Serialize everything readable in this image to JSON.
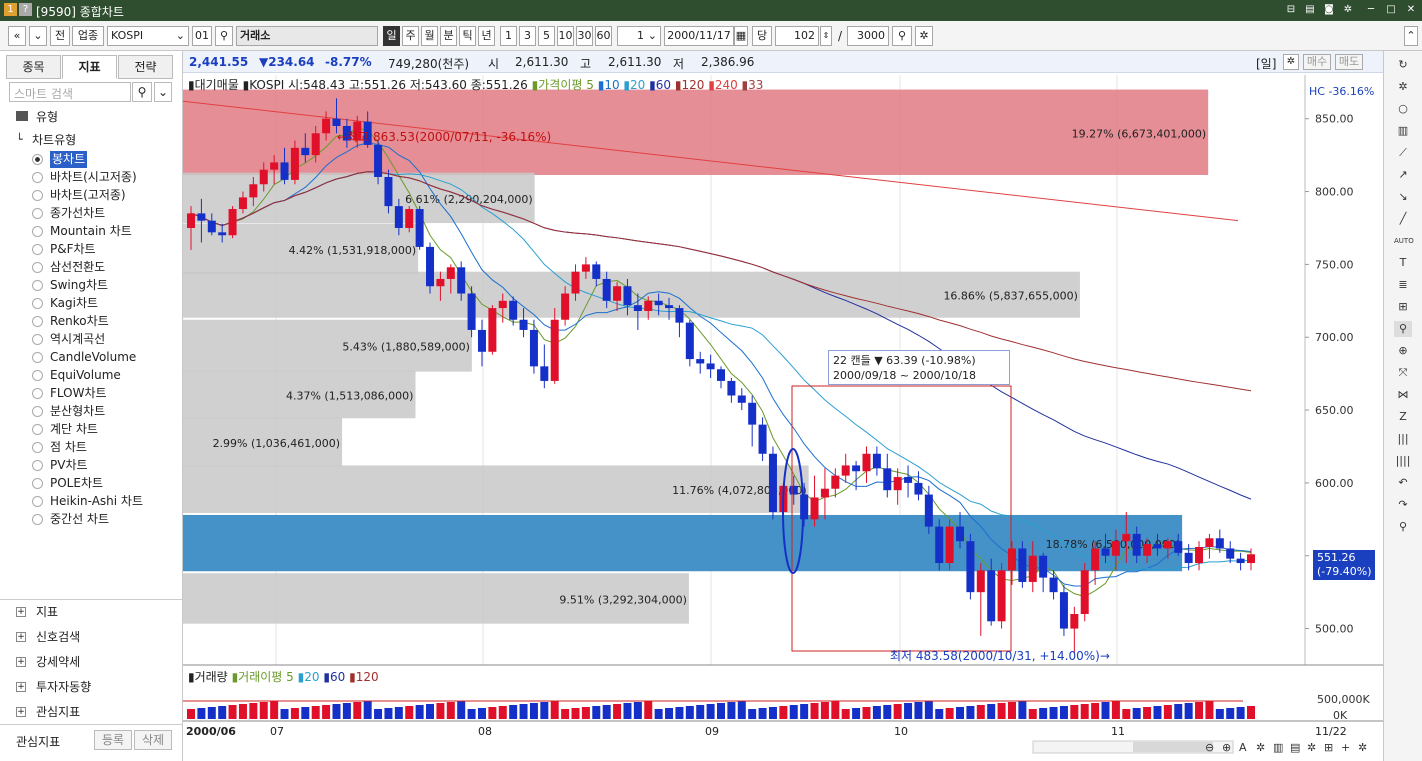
{
  "titlebar": {
    "icon1": "1",
    "icon2": "?",
    "title": "[9590] 종합차트"
  },
  "toolbar": {
    "nav_prev": "«",
    "nav_down": "»",
    "prev_label": "전",
    "market_type": "업종",
    "index_name": "KOSPI",
    "index_code": "01",
    "exchange": "거래소",
    "period_tabs": [
      "일",
      "주",
      "월",
      "분",
      "틱",
      "년"
    ],
    "intervals": [
      "1",
      "3",
      "5",
      "10",
      "30",
      "60"
    ],
    "count_value": "1",
    "date_value": "2000/11/17",
    "date_label": "당",
    "view_count": "102",
    "total_count": "3000",
    "colors": {
      "active": "#333333"
    }
  },
  "leftpanel": {
    "tabs": [
      "종목",
      "지표",
      "전략"
    ],
    "search_placeholder": "스마트 검색",
    "group_label": "유형",
    "subgroup_label": "차트유형",
    "chart_types": [
      "봉차트",
      "바차트(시고저종)",
      "바차트(고저종)",
      "종가선차트",
      "Mountain 차트",
      "P&F차트",
      "삼선전환도",
      "Swing차트",
      "Kagi차트",
      "Renko차트",
      "역시계곡선",
      "CandleVolume",
      "EquiVolume",
      "FLOW차트",
      "분산형차트",
      "계단 차트",
      "점 차트",
      "PV차트",
      "POLE차트",
      "Heikin-Ashi 차트",
      "중간선 차트"
    ],
    "selected_type": "봉차트",
    "sections": [
      "지표",
      "신호검색",
      "강세약세",
      "투자자동향",
      "관심지표"
    ],
    "footer": {
      "label": "관심지표",
      "register": "등록",
      "delete": "삭제"
    }
  },
  "quote": {
    "price": "2,441.55",
    "change": "▼234.64",
    "pct": "-8.77%",
    "volume": "749,280(천주)",
    "open_label": "시",
    "open": "2,611.30",
    "high_label": "고",
    "high": "2,611.30",
    "low_label": "저",
    "low": "2,386.96",
    "period": "[일]",
    "buy": "매수",
    "sell": "매도"
  },
  "legend": {
    "prefix": "▮대기매물",
    "ohlc": "▮KOSPI 시:548.43 고:551.26 저:543.60 종:551.26",
    "ma_label": "가격이평",
    "ma": [
      "5",
      "10",
      "20",
      "60",
      "120",
      "240",
      "33"
    ],
    "hc": "HC -36.16%",
    "cur_price": "551.26",
    "cur_pct": "(-79.40%)"
  },
  "annotations": {
    "high": "←최고 863.53(2000/07/11, -36.16%)",
    "low": "최저 483.58(2000/10/31, +14.00%)→",
    "box_title": "22 캔들 ▼ 63.39 (-10.98%)",
    "box_range": "2000/09/18 ~ 2000/10/18"
  },
  "volume_legend": {
    "prefix": "▮거래량",
    "ma_label": "거래이평",
    "ma": [
      "5",
      "20",
      "60",
      "120"
    ],
    "ticks": [
      "500,000K",
      "0K"
    ]
  },
  "chart_data": {
    "type": "candlestick",
    "title": "KOSPI",
    "ylim": [
      475,
      880
    ],
    "yticks": [
      "850.00",
      "800.00",
      "750.00",
      "700.00",
      "650.00",
      "600.00",
      "550.00",
      "500.00"
    ],
    "xticks": [
      "2000/06",
      "07",
      "08",
      "09",
      "10",
      "11",
      "11/22"
    ],
    "volume_profile": [
      {
        "range": [
          810,
          870
        ],
        "label": "19.27% (6,673,401,000)",
        "highlight": "red"
      },
      {
        "range": [
          777,
          813
        ],
        "label": "6.61% (2,290,204,000)"
      },
      {
        "range": [
          742,
          778
        ],
        "label": "4.42% (1,531,918,000)"
      },
      {
        "range": [
          712,
          745
        ],
        "label": "16.86% (5,837,655,000)"
      },
      {
        "range": [
          675,
          712
        ],
        "label": "5.43% (1,880,589,000)"
      },
      {
        "range": [
          643,
          677
        ],
        "label": "4.37% (1,513,086,000)"
      },
      {
        "range": [
          610,
          645
        ],
        "label": "2.99% (1,036,461,000)"
      },
      {
        "range": [
          578,
          612
        ],
        "label": "11.76% (4,072,804,000)"
      },
      {
        "range": [
          538,
          578
        ],
        "label": "18.78% (6,500,000,000)",
        "highlight": "blue"
      },
      {
        "range": [
          502,
          538
        ],
        "label": "9.51% (3,292,304,000)"
      }
    ],
    "candles": [
      [
        775,
        790,
        760,
        785
      ],
      [
        785,
        795,
        765,
        780
      ],
      [
        780,
        785,
        770,
        772
      ],
      [
        772,
        778,
        765,
        770
      ],
      [
        770,
        790,
        768,
        788
      ],
      [
        788,
        800,
        785,
        796
      ],
      [
        796,
        810,
        790,
        805
      ],
      [
        805,
        820,
        800,
        815
      ],
      [
        815,
        825,
        805,
        820
      ],
      [
        820,
        830,
        805,
        808
      ],
      [
        808,
        835,
        805,
        830
      ],
      [
        830,
        840,
        820,
        825
      ],
      [
        825,
        845,
        820,
        840
      ],
      [
        840,
        855,
        835,
        850
      ],
      [
        850,
        864,
        840,
        845
      ],
      [
        845,
        850,
        830,
        835
      ],
      [
        835,
        852,
        830,
        848
      ],
      [
        848,
        855,
        830,
        832
      ],
      [
        832,
        835,
        805,
        810
      ],
      [
        810,
        815,
        785,
        790
      ],
      [
        790,
        795,
        770,
        775
      ],
      [
        775,
        790,
        772,
        788
      ],
      [
        788,
        790,
        760,
        762
      ],
      [
        762,
        765,
        730,
        735
      ],
      [
        735,
        745,
        725,
        740
      ],
      [
        740,
        750,
        730,
        748
      ],
      [
        748,
        752,
        725,
        730
      ],
      [
        730,
        735,
        700,
        705
      ],
      [
        705,
        712,
        680,
        690
      ],
      [
        690,
        722,
        688,
        720
      ],
      [
        720,
        730,
        710,
        725
      ],
      [
        725,
        728,
        708,
        712
      ],
      [
        712,
        720,
        700,
        705
      ],
      [
        705,
        712,
        675,
        680
      ],
      [
        680,
        695,
        665,
        670
      ],
      [
        670,
        720,
        668,
        712
      ],
      [
        712,
        735,
        708,
        730
      ],
      [
        730,
        750,
        725,
        745
      ],
      [
        745,
        755,
        740,
        750
      ],
      [
        750,
        752,
        735,
        740
      ],
      [
        740,
        745,
        720,
        725
      ],
      [
        725,
        738,
        718,
        735
      ],
      [
        735,
        740,
        715,
        722
      ],
      [
        722,
        730,
        705,
        718
      ],
      [
        718,
        728,
        712,
        725
      ],
      [
        725,
        730,
        715,
        722
      ],
      [
        722,
        727,
        712,
        720
      ],
      [
        720,
        722,
        700,
        710
      ],
      [
        710,
        712,
        680,
        685
      ],
      [
        685,
        690,
        675,
        682
      ],
      [
        682,
        688,
        672,
        678
      ],
      [
        678,
        680,
        665,
        670
      ],
      [
        670,
        672,
        655,
        660
      ],
      [
        660,
        665,
        650,
        655
      ],
      [
        655,
        660,
        625,
        640
      ],
      [
        640,
        645,
        615,
        620
      ],
      [
        620,
        625,
        575,
        580
      ],
      [
        580,
        600,
        570,
        598
      ],
      [
        598,
        605,
        585,
        592
      ],
      [
        592,
        600,
        570,
        575
      ],
      [
        575,
        605,
        570,
        590
      ],
      [
        590,
        610,
        575,
        596
      ],
      [
        596,
        610,
        590,
        605
      ],
      [
        605,
        620,
        600,
        612
      ],
      [
        612,
        615,
        595,
        608
      ],
      [
        608,
        625,
        600,
        620
      ],
      [
        620,
        625,
        605,
        610
      ],
      [
        610,
        620,
        590,
        595
      ],
      [
        595,
        610,
        585,
        604
      ],
      [
        604,
        612,
        590,
        600
      ],
      [
        600,
        608,
        588,
        592
      ],
      [
        592,
        598,
        565,
        570
      ],
      [
        570,
        575,
        540,
        545
      ],
      [
        545,
        575,
        540,
        570
      ],
      [
        570,
        580,
        555,
        560
      ],
      [
        560,
        565,
        520,
        525
      ],
      [
        525,
        545,
        495,
        540
      ],
      [
        540,
        548,
        502,
        505
      ],
      [
        505,
        545,
        500,
        540
      ],
      [
        540,
        560,
        530,
        555
      ],
      [
        555,
        560,
        528,
        532
      ],
      [
        532,
        560,
        525,
        550
      ],
      [
        550,
        552,
        525,
        535
      ],
      [
        535,
        540,
        520,
        525
      ],
      [
        525,
        530,
        495,
        500
      ],
      [
        500,
        515,
        483,
        510
      ],
      [
        510,
        545,
        505,
        540
      ],
      [
        540,
        560,
        530,
        555
      ],
      [
        555,
        565,
        545,
        550
      ],
      [
        550,
        568,
        540,
        560
      ],
      [
        560,
        580,
        545,
        565
      ],
      [
        565,
        570,
        545,
        550
      ],
      [
        550,
        562,
        545,
        558
      ],
      [
        558,
        565,
        550,
        555
      ],
      [
        555,
        562,
        548,
        560
      ],
      [
        560,
        565,
        550,
        552
      ],
      [
        552,
        558,
        540,
        545
      ],
      [
        545,
        560,
        540,
        556
      ],
      [
        556,
        565,
        548,
        562
      ],
      [
        562,
        568,
        552,
        555
      ],
      [
        555,
        560,
        545,
        548
      ],
      [
        548,
        552,
        540,
        545
      ],
      [
        545,
        555,
        540,
        551
      ]
    ]
  }
}
